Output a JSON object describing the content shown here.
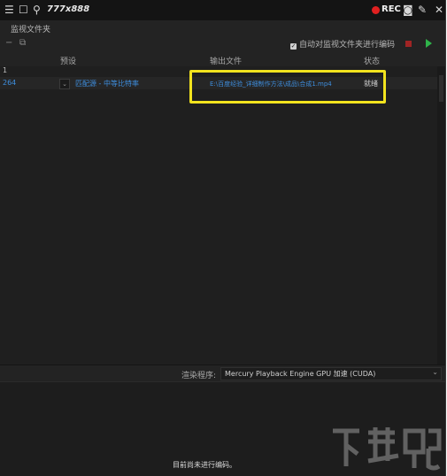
{
  "recbar": {
    "menu_icon": "☰",
    "window_icon": "☐",
    "search_icon": "⚲",
    "size": "777x888",
    "rec_label": "REC",
    "camera_icon": "◙",
    "pen_icon": "✎",
    "close_icon": "✕"
  },
  "panel": {
    "title": "监视文件夹"
  },
  "toolbar": {
    "minus_icon": "−",
    "copy_icon": "⧉",
    "auto_encode_label": "自动对监视文件夹进行编码"
  },
  "columns": {
    "preset": "预设",
    "output": "输出文件",
    "status": "状态"
  },
  "queue": {
    "group_label": "1",
    "item": {
      "format": "264",
      "preset": "匹配源 - 中等比特率",
      "output": "E:\\百度经验_详细制作方法\\成品\\合成1.mp4",
      "status": "就绪"
    }
  },
  "renderer": {
    "label": "渲染程序:",
    "value": "Mercury Playback Engine GPU 加速 (CUDA)"
  },
  "encode": {
    "message": "目前尚未进行编码。"
  },
  "watermark": {
    "text": "下载吧"
  },
  "colors": {
    "link_blue": "#3e8ede",
    "highlight_yellow": "#f2e31e",
    "rec_red": "#e02020",
    "play_green": "#2fb34a"
  }
}
